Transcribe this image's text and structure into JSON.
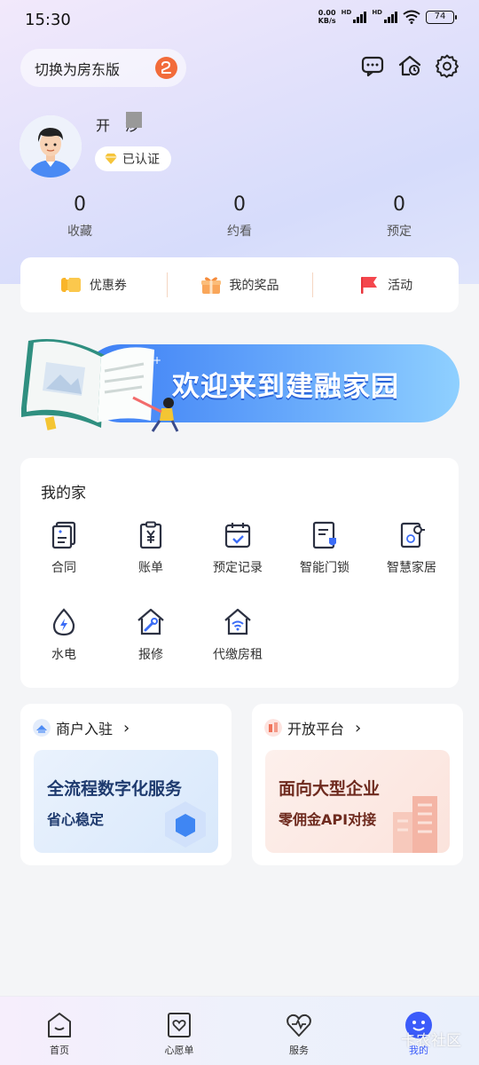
{
  "status": {
    "time": "15:30",
    "speed_top": "0.00",
    "speed_bottom": "KB/s",
    "battery": "74"
  },
  "header": {
    "switch_label": "切换为房东版",
    "switch_icon": "⇄"
  },
  "profile": {
    "name": "开 涉",
    "verified": "已认证"
  },
  "stats": [
    {
      "value": "0",
      "label": "收藏"
    },
    {
      "value": "0",
      "label": "约看"
    },
    {
      "value": "0",
      "label": "预定"
    }
  ],
  "quick": [
    {
      "label": "优惠券",
      "icon": "coupon-icon"
    },
    {
      "label": "我的奖品",
      "icon": "gift-icon"
    },
    {
      "label": "活动",
      "icon": "flag-icon"
    }
  ],
  "banner": {
    "text": "欢迎来到建融家园"
  },
  "home": {
    "title": "我的家",
    "items": [
      {
        "label": "合同"
      },
      {
        "label": "账单"
      },
      {
        "label": "预定记录"
      },
      {
        "label": "智能门锁"
      },
      {
        "label": "智慧家居"
      },
      {
        "label": "水电"
      },
      {
        "label": "报修"
      },
      {
        "label": "代缴房租"
      }
    ]
  },
  "promos": [
    {
      "title": "商户入驻",
      "line1": "全流程数字化服务",
      "line2": "省心稳定"
    },
    {
      "title": "开放平台",
      "line1": "面向大型企业",
      "line2": "零佣金API对接"
    }
  ],
  "tabs": [
    {
      "label": "首页"
    },
    {
      "label": "心愿单"
    },
    {
      "label": "服务"
    },
    {
      "label": "我的"
    }
  ],
  "watermark": "卡农社区"
}
